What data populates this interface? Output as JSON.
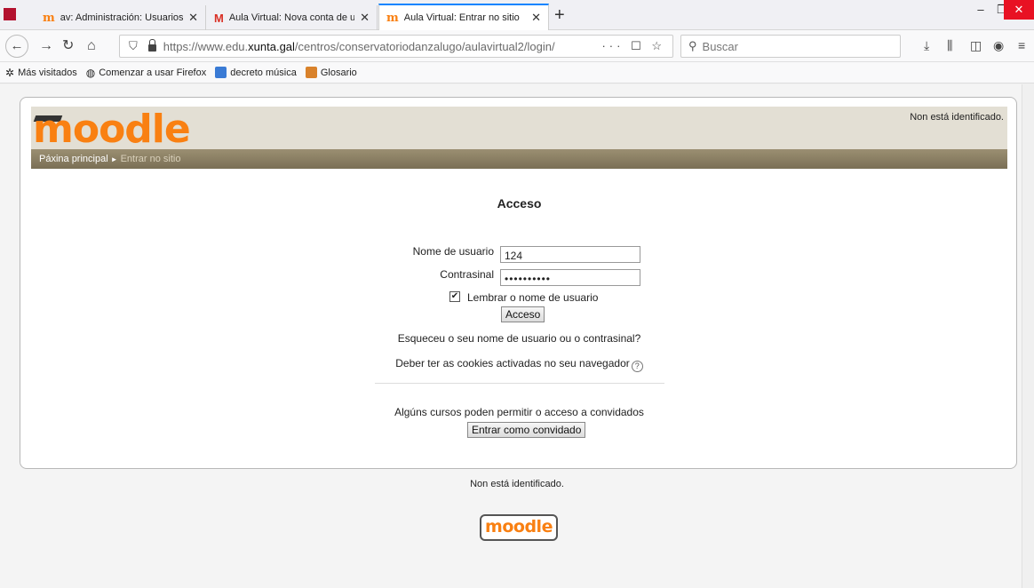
{
  "browser": {
    "tabs": [
      {
        "label": "av: Administración: Usuarios: C"
      },
      {
        "label": "Aula Virtual: Nova conta de usu"
      },
      {
        "label": "Aula Virtual: Entrar no sitio"
      }
    ],
    "new_tab": "+",
    "url_prefix": "https://www.edu.",
    "url_host": "xunta.gal",
    "url_rest": "/centros/conservatoriodanzalugo/aulavirtual2/login/",
    "url_tools": "··· ☐ ☆",
    "search_placeholder": "Buscar",
    "bookmarks": [
      {
        "label": "Más visitados",
        "icon": "gear-icon"
      },
      {
        "label": "Comenzar a usar Firefox",
        "icon": "globe-icon"
      },
      {
        "label": "decreto música",
        "icon": "app-icon"
      },
      {
        "label": "Glosario",
        "icon": "app-icon"
      }
    ]
  },
  "header": {
    "logo_text": "moodle",
    "login_info": "Non está identificado.",
    "breadcrumb_home": "Páxina principal",
    "breadcrumb_sep": "►",
    "breadcrumb_current": "Entrar no sitio"
  },
  "login": {
    "title": "Acceso",
    "username_label": "Nome de usuario",
    "username_value": "124",
    "password_label": "Contrasinal",
    "password_value": "••••••••••",
    "remember_label": "Lembrar o nome de usuario",
    "remember_checked": true,
    "submit_label": "Acceso",
    "forgot_text": "Esqueceu o seu nome de usuario ou o contrasinal?",
    "cookies_text": "Deber ter as cookies activadas no seu navegador",
    "guest_text": "Algúns cursos poden permitir o acceso a convidados",
    "guest_button": "Entrar como convidado"
  },
  "footer": {
    "login_info": "Non está identificado.",
    "logo_text": "moodle"
  },
  "colors": {
    "moodle_orange": "#f98012",
    "header_bg": "#e3dfd4",
    "breadcrumb_bg": "#8e8265",
    "close_red": "#e81123",
    "tab_accent": "#0a84ff"
  }
}
